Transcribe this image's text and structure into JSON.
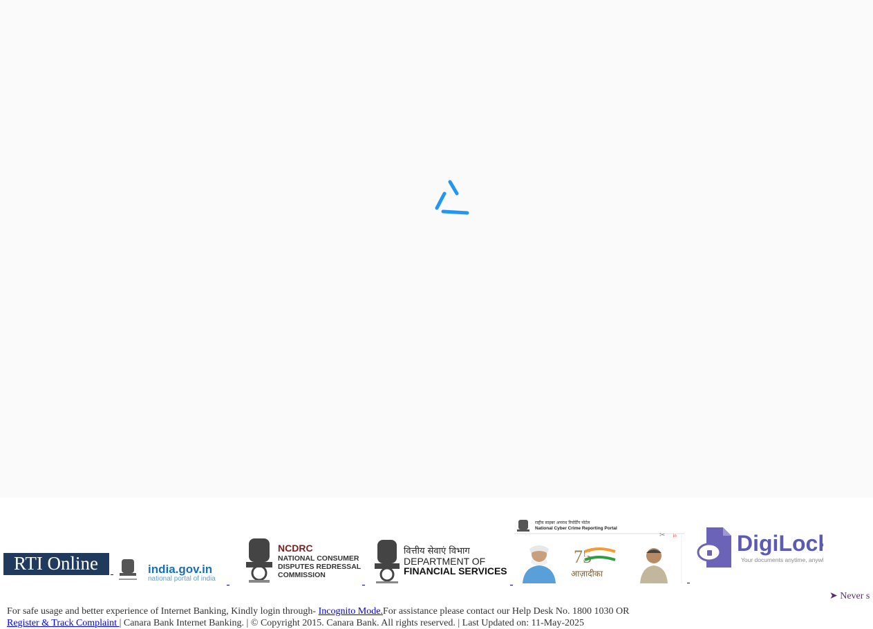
{
  "logos": [
    {
      "name": "RTI Online"
    },
    {
      "name": "india.gov.in",
      "tagline": "national portal of india"
    },
    {
      "name": "NCDRC",
      "line1": "NATIONAL CONSUMER",
      "line2": "DISPUTES REDRESSAL",
      "line3": "COMMISSION"
    },
    {
      "name": "DEPARTMENT OF",
      "hindi": "वित्तीय सेवाएं विभाग",
      "line2": "FINANCIAL SERVICES"
    },
    {
      "name": "National Cyber Crime Reporting Portal",
      "hindi": "राष्ट्रीय साइबर अपराध रिपोर्टिंग पोर्टल",
      "azadi": "आज़ादीका"
    },
    {
      "name": "DigiLocker",
      "tagline": "Your documents anytime, anywhere"
    }
  ],
  "ticker": {
    "text": "➤ Never s"
  },
  "footer": {
    "line1_prefix": "For safe usage and better experience of Internet Banking, Kindly login through- ",
    "incognito_link": "Incognito Mode.",
    "line1_suffix": "For assistance please contact our Help Desk No. 1800 1030 OR",
    "complaint_link": "Register & Track Complaint ",
    "line2_suffix": "| Canara Bank Internet Banking. | © Copyright 2015. Canara Bank. All rights reserved. | Last Updated on: 11-May-2025"
  },
  "colors": {
    "loader_bg": "#fafafa",
    "spinner": "#2196f3",
    "link": "#0000ee",
    "ticker": "#5b2f6e"
  }
}
